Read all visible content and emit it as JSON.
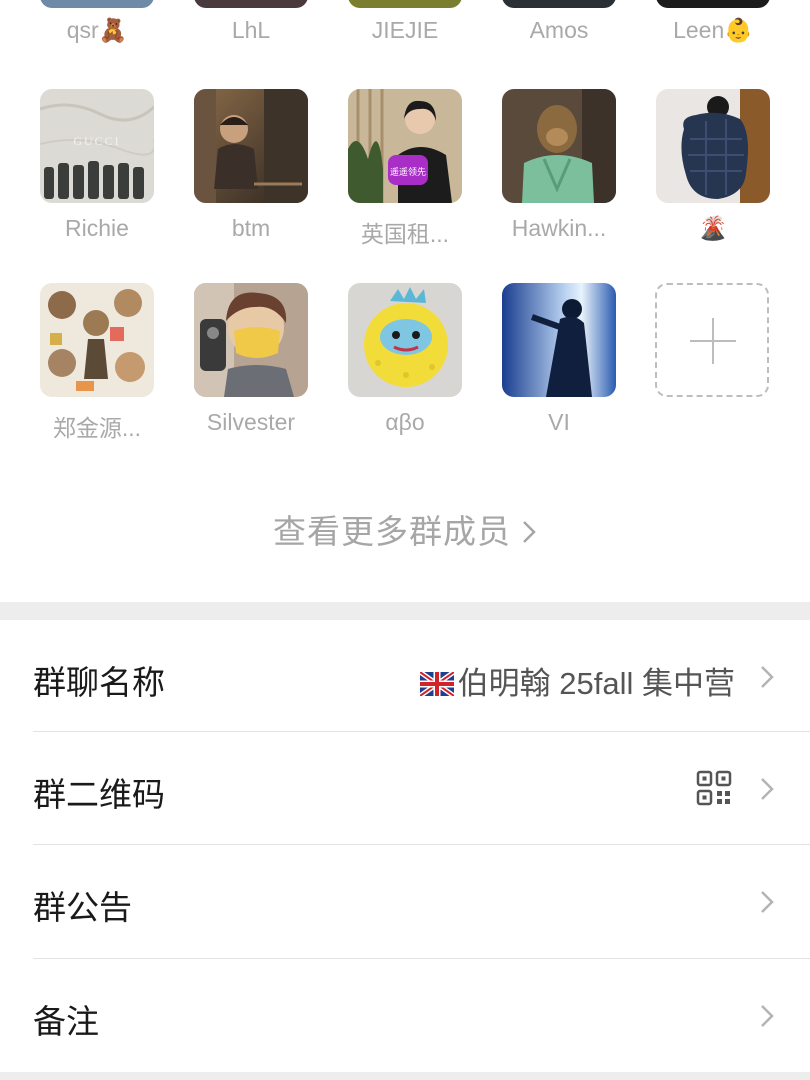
{
  "members_row_top": [
    "qsr🧸",
    "LhL",
    "JIEJIE",
    "Amos",
    "Leen👶"
  ],
  "members_row_2": [
    "Richie",
    "btm",
    "英国租...",
    "Hawkin...",
    "🌋"
  ],
  "members_row_3": [
    "郑金源...",
    "Silvester",
    "αβο",
    "VI"
  ],
  "avatar_2_3_text": "GUCCI",
  "avatar_2_3_badge": "遥遥领先",
  "view_more": "查看更多群成员",
  "settings": {
    "group_name_label": "群聊名称",
    "group_name_value": "伯明翰 25fall 集中营",
    "qr_label": "群二维码",
    "notice_label": "群公告",
    "remark_label": "备注"
  },
  "icons": {
    "add": "add-member-icon",
    "chevron": "chevron-right-icon",
    "qr": "qr-code-icon",
    "flag": "uk-flag-icon"
  }
}
